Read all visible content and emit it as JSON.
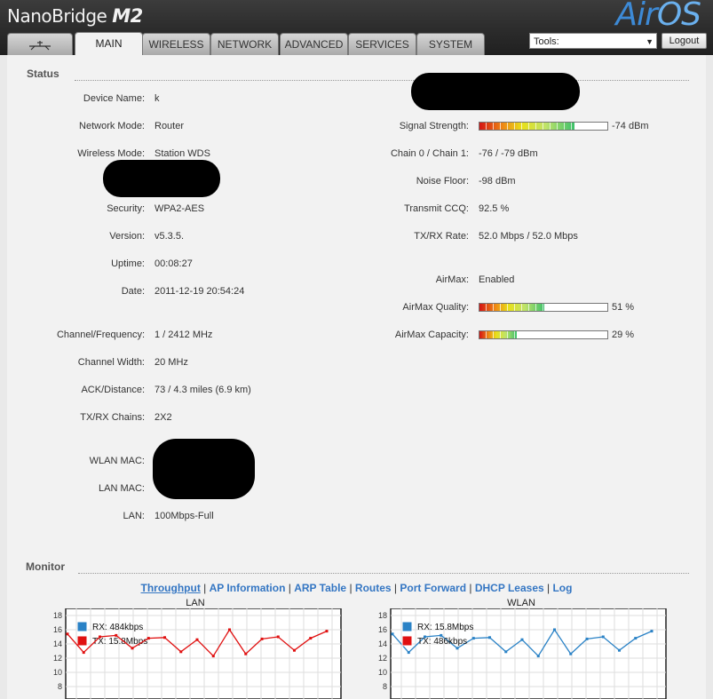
{
  "header": {
    "brand_name": "NanoBridge",
    "brand_model": "M2",
    "logo_air": "Air",
    "logo_os": "OS"
  },
  "tabs": [
    "MAIN",
    "WIRELESS",
    "NETWORK",
    "ADVANCED",
    "SERVICES",
    "SYSTEM"
  ],
  "tools": {
    "selected": "Tools:",
    "logout_label": "Logout"
  },
  "status": {
    "title": "Status",
    "left": [
      {
        "label": "Device Name:",
        "value": "k"
      },
      {
        "label": "Network Mode:",
        "value": "Router"
      },
      {
        "label": "Wireless Mode:",
        "value": "Station WDS"
      },
      {
        "label": "Security:",
        "value": "WPA2-AES"
      },
      {
        "label": "Version:",
        "value": "v5.3.5."
      },
      {
        "label": "Uptime:",
        "value": "00:08:27"
      },
      {
        "label": "Date:",
        "value": "2011-12-19 20:54:24"
      },
      {
        "label": "Channel/Frequency:",
        "value": "1 / 2412 MHz"
      },
      {
        "label": "Channel Width:",
        "value": "20 MHz"
      },
      {
        "label": "ACK/Distance:",
        "value": "73 / 4.3 miles (6.9 km)"
      },
      {
        "label": "TX/RX Chains:",
        "value": "2X2"
      },
      {
        "label": "WLAN MAC:",
        "value": ""
      },
      {
        "label": "LAN MAC:",
        "value": ""
      },
      {
        "label": "LAN:",
        "value": "100Mbps-Full"
      }
    ],
    "right": [
      {
        "label": "Signal Strength:",
        "value": "-74 dBm",
        "level": 0.74
      },
      {
        "label": "Chain 0 / Chain 1:",
        "value": "-76 / -79 dBm"
      },
      {
        "label": "Noise Floor:",
        "value": "-98 dBm"
      },
      {
        "label": "Transmit CCQ:",
        "value": "92.5 %"
      },
      {
        "label": "TX/RX Rate:",
        "value": "52.0 Mbps / 52.0 Mbps"
      },
      {
        "label": "AirMax:",
        "value": "Enabled"
      },
      {
        "label": "AirMax Quality:",
        "value": "51 %",
        "level": 0.51
      },
      {
        "label": "AirMax Capacity:",
        "value": "29 %",
        "level": 0.29
      }
    ]
  },
  "monitor": {
    "title": "Monitor",
    "links": [
      "Throughput",
      "AP Information",
      "ARP Table",
      "Routes",
      "Port Forward",
      "DHCP Leases",
      "Log"
    ]
  },
  "chart_data": [
    {
      "type": "line",
      "title": "LAN",
      "y_ticks": [
        18,
        16,
        14,
        12,
        10,
        8
      ],
      "series": [
        {
          "name": "RX: 484kbps",
          "color": "#2a82c6",
          "values": []
        },
        {
          "name": "TX: 15.8Mbps",
          "color": "#e01010",
          "values": [
            15.4,
            12.8,
            15.0,
            15.2,
            13.4,
            14.8,
            14.9,
            12.9,
            14.6,
            12.3,
            16.0,
            12.6,
            14.7,
            15.0,
            13.1,
            14.8,
            15.8
          ]
        }
      ]
    },
    {
      "type": "line",
      "title": "WLAN",
      "y_ticks": [
        18,
        16,
        14,
        12,
        10,
        8
      ],
      "series": [
        {
          "name": "RX: 15.8Mbps",
          "color": "#2a82c6",
          "values": [
            15.4,
            12.8,
            15.0,
            15.2,
            13.4,
            14.8,
            14.9,
            12.9,
            14.6,
            12.3,
            16.0,
            12.6,
            14.7,
            15.0,
            13.1,
            14.8,
            15.8
          ]
        },
        {
          "name": "TX: 486kbps",
          "color": "#e01010",
          "values": []
        }
      ]
    }
  ]
}
